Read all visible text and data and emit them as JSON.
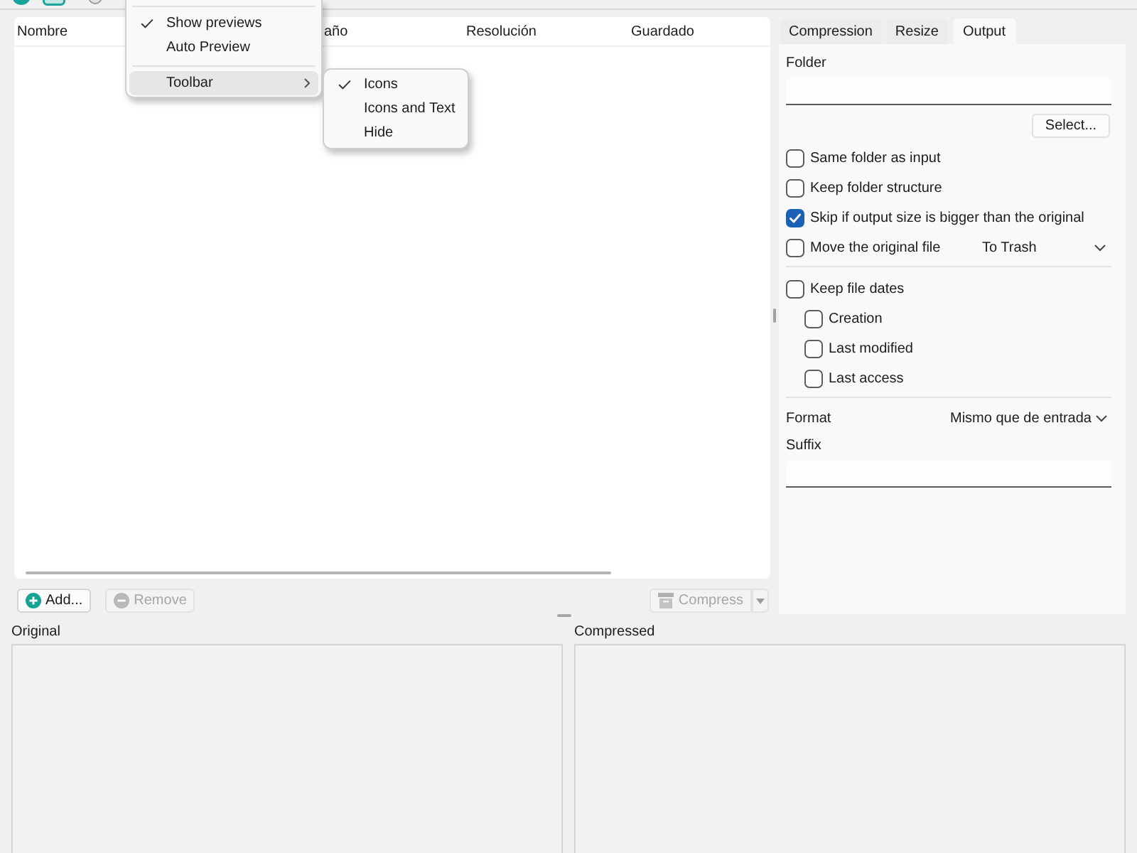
{
  "file_table": {
    "columns": [
      "Nombre",
      "año",
      "Resolución",
      "Guardado"
    ]
  },
  "view_menu": {
    "sections": [
      {
        "items": [
          {
            "kind": "check",
            "label": "Show previews",
            "checked": true,
            "selected": false
          },
          {
            "kind": "check",
            "label": "Auto Preview",
            "checked": false,
            "selected": false
          }
        ]
      },
      {
        "items": [
          {
            "kind": "submenu",
            "label": "Toolbar",
            "checked": false,
            "selected": true,
            "submenu": {
              "items": [
                {
                  "label": "Icons",
                  "checked": true
                },
                {
                  "label": "Icons and Text",
                  "checked": false
                },
                {
                  "label": "Hide",
                  "checked": false
                }
              ]
            }
          }
        ]
      }
    ]
  },
  "settings_tabs": [
    {
      "label": "Compression",
      "selected": false
    },
    {
      "label": "Resize",
      "selected": false
    },
    {
      "label": "Output",
      "selected": true
    }
  ],
  "output_tab": {
    "folder_label": "Folder",
    "select_button": "Select...",
    "option_groups": [
      {
        "options": [
          {
            "kind": "checkbox",
            "label": "Same folder as input",
            "checked": false
          },
          {
            "kind": "checkbox",
            "label": "Keep folder structure",
            "checked": false
          },
          {
            "kind": "checkbox",
            "label": "Skip if output size is bigger than the original",
            "checked": true
          },
          {
            "kind": "checkbox-select",
            "label": "Move the original file",
            "checked": false,
            "value": "To Trash"
          }
        ]
      },
      {
        "options": [
          {
            "kind": "checkbox",
            "label": "Keep file dates",
            "checked": false,
            "children": [
              {
                "kind": "checkbox",
                "label": "Creation",
                "checked": false
              },
              {
                "kind": "checkbox",
                "label": "Last modified",
                "checked": false
              },
              {
                "kind": "checkbox",
                "label": "Last access",
                "checked": false
              }
            ]
          }
        ]
      }
    ],
    "format": {
      "label": "Format",
      "value": "Mismo que de entrada"
    },
    "suffix_label": "Suffix"
  },
  "file_buttons": [
    {
      "kind": "add",
      "label": "Add...",
      "disabled": false
    },
    {
      "kind": "remove",
      "label": "Remove",
      "disabled": true
    }
  ],
  "compress_button": {
    "label": "Compress",
    "disabled": true
  },
  "previews": [
    {
      "label": "Original"
    },
    {
      "label": "Compressed"
    }
  ]
}
